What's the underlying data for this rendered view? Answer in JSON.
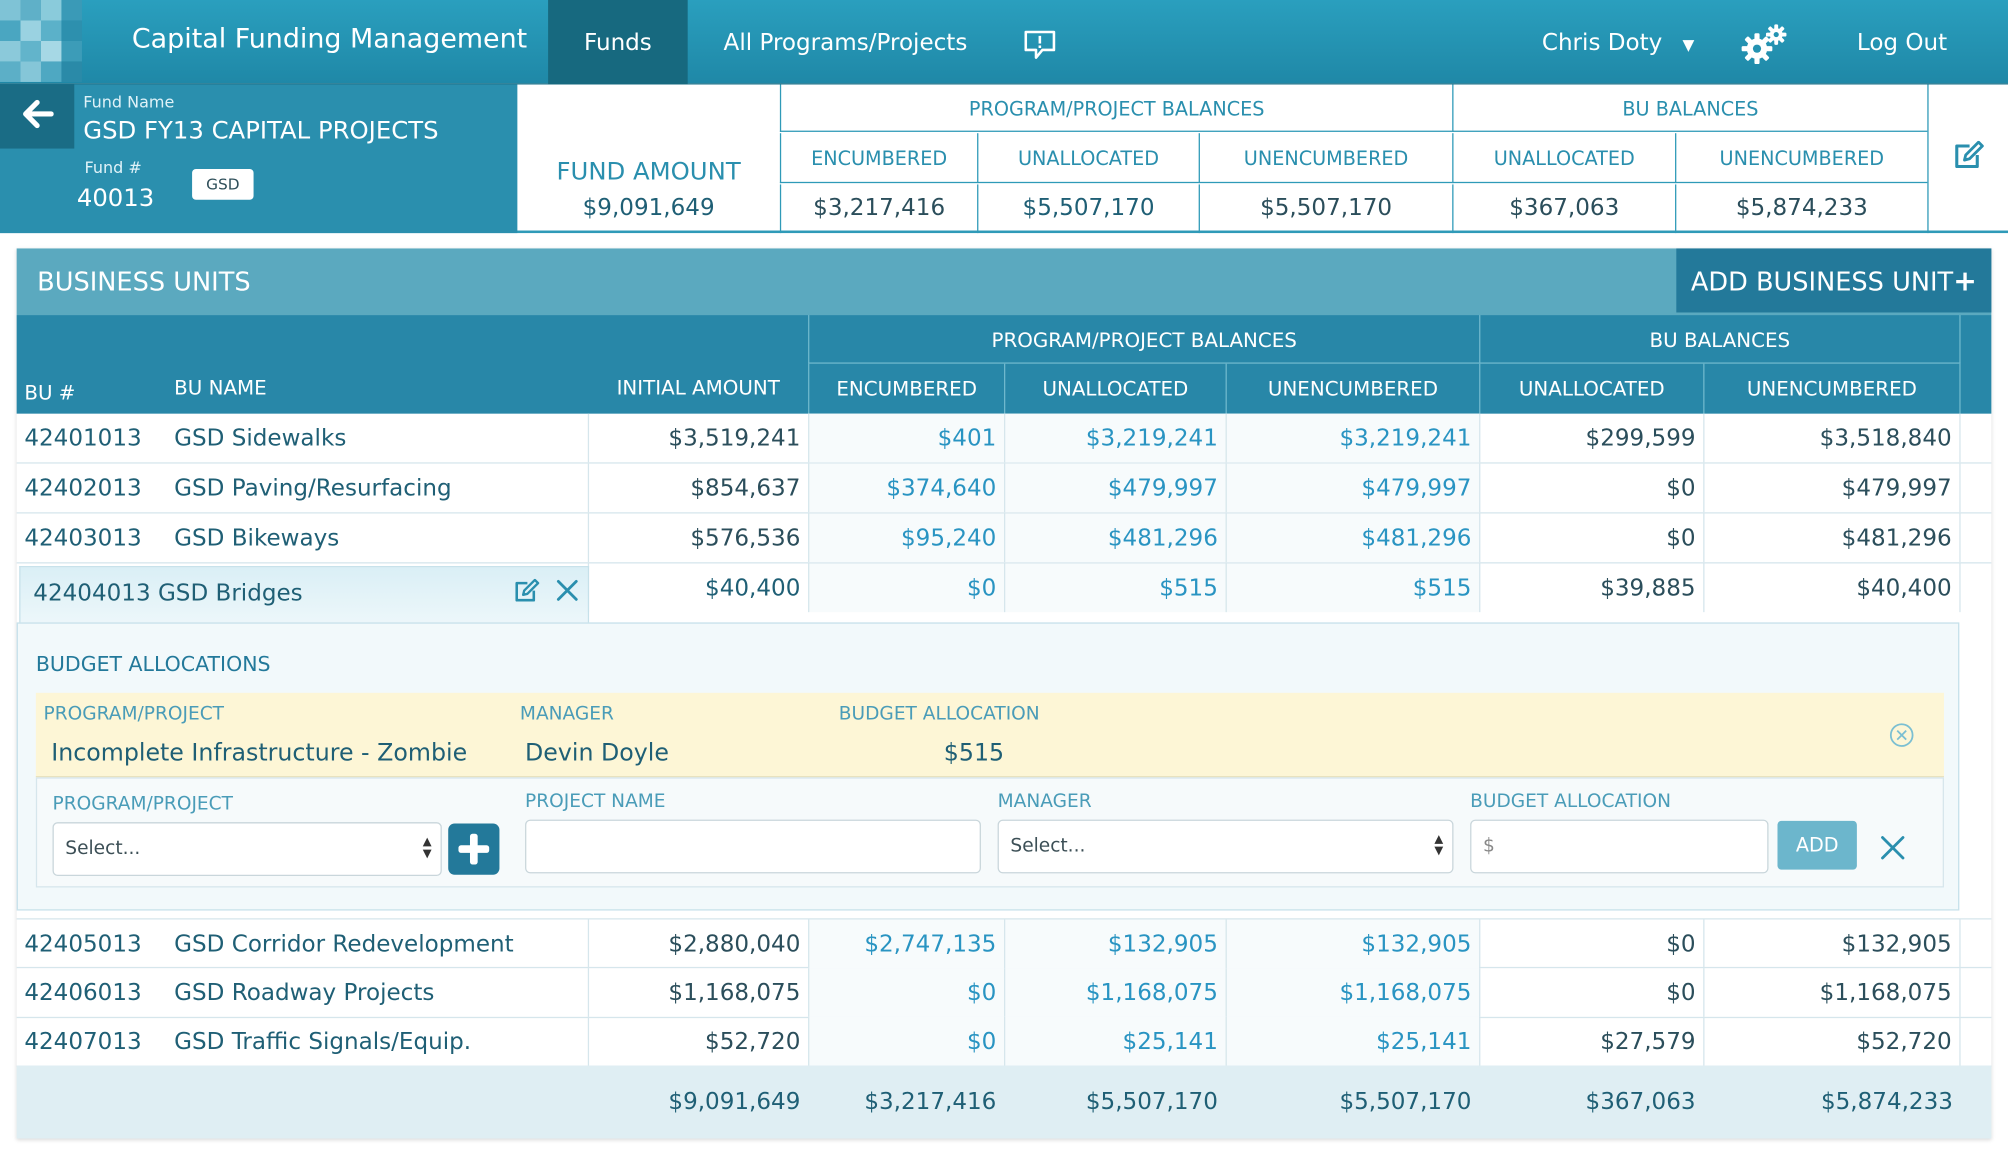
{
  "app_title": "Capital Funding Management",
  "nav": {
    "funds": "Funds",
    "programs": "All Programs/Projects",
    "user": "Chris Doty",
    "logout": "Log Out"
  },
  "fund": {
    "name_label": "Fund Name",
    "name": "GSD FY13 CAPITAL PROJECTS",
    "number_label": "Fund #",
    "number": "40013",
    "badge": "GSD",
    "amount_label": "FUND AMOUNT",
    "amount": "$9,091,649",
    "program_balances_label": "PROGRAM/PROJECT BALANCES",
    "bu_balances_label": "BU BALANCES",
    "columns": {
      "encumbered": "ENCUMBERED",
      "unallocated": "UNALLOCATED",
      "unencumbered": "UNENCUMBERED",
      "bu_unallocated": "UNALLOCATED",
      "bu_unencumbered": "UNENCUMBERED"
    },
    "values": {
      "encumbered": "$3,217,416",
      "unallocated": "$5,507,170",
      "unencumbered": "$5,507,170",
      "bu_unallocated": "$367,063",
      "bu_unencumbered": "$5,874,233"
    }
  },
  "business_units": {
    "title": "BUSINESS UNITS",
    "add_button": "ADD BUSINESS UNIT",
    "headers": {
      "bu_num": "BU #",
      "bu_name": "BU NAME",
      "initial": "INITIAL AMOUNT",
      "program_balances": "PROGRAM/PROJECT BALANCES",
      "bu_balances": "BU BALANCES",
      "encumbered": "ENCUMBERED",
      "unallocated": "UNALLOCATED",
      "unencumbered": "UNENCUMBERED",
      "bu_unallocated": "UNALLOCATED",
      "bu_unencumbered": "UNENCUMBERED"
    },
    "rows": [
      {
        "num": "42401013",
        "name": "GSD Sidewalks",
        "initial": "$3,519,241",
        "encumbered": "$401",
        "unallocated": "$3,219,241",
        "unencumbered": "$3,219,241",
        "bu_unallocated": "$299,599",
        "bu_unencumbered": "$3,518,840"
      },
      {
        "num": "42402013",
        "name": "GSD Paving/Resurfacing",
        "initial": "$854,637",
        "encumbered": "$374,640",
        "unallocated": "$479,997",
        "unencumbered": "$479,997",
        "bu_unallocated": "$0",
        "bu_unencumbered": "$479,997"
      },
      {
        "num": "42403013",
        "name": "GSD Bikeways",
        "initial": "$576,536",
        "encumbered": "$95,240",
        "unallocated": "$481,296",
        "unencumbered": "$481,296",
        "bu_unallocated": "$0",
        "bu_unencumbered": "$481,296"
      },
      {
        "num": "42404013",
        "name": "GSD Bridges",
        "initial": "$40,400",
        "encumbered": "$0",
        "unallocated": "$515",
        "unencumbered": "$515",
        "bu_unallocated": "$39,885",
        "bu_unencumbered": "$40,400"
      },
      {
        "num": "42405013",
        "name": "GSD Corridor Redevelopment",
        "initial": "$2,880,040",
        "encumbered": "$2,747,135",
        "unallocated": "$132,905",
        "unencumbered": "$132,905",
        "bu_unallocated": "$0",
        "bu_unencumbered": "$132,905"
      },
      {
        "num": "42406013",
        "name": "GSD Roadway Projects",
        "initial": "$1,168,075",
        "encumbered": "$0",
        "unallocated": "$1,168,075",
        "unencumbered": "$1,168,075",
        "bu_unallocated": "$0",
        "bu_unencumbered": "$1,168,075"
      },
      {
        "num": "42407013",
        "name": "GSD Traffic Signals/Equip.",
        "initial": "$52,720",
        "encumbered": "$0",
        "unallocated": "$25,141",
        "unencumbered": "$25,141",
        "bu_unallocated": "$27,579",
        "bu_unencumbered": "$52,720"
      }
    ],
    "expanded": {
      "title": "42404013 GSD Bridges",
      "budget_allocations_title": "BUDGET ALLOCATIONS",
      "labels": {
        "program": "PROGRAM/PROJECT",
        "manager": "MANAGER",
        "budget": "BUDGET ALLOCATION",
        "project_name": "PROJECT NAME"
      },
      "allocation": {
        "program": "Incomplete Infrastructure - Zombie",
        "manager": "Devin Doyle",
        "budget": "$515"
      },
      "new_allocation": {
        "program_placeholder": "Select...",
        "manager_placeholder": "Select...",
        "budget_prefix": "$",
        "add_button": "ADD"
      }
    },
    "totals": {
      "initial": "$9,091,649",
      "encumbered": "$3,217,416",
      "unallocated": "$5,507,170",
      "unencumbered": "$5,507,170",
      "bu_unallocated": "$367,063",
      "bu_unencumbered": "$5,874,233"
    }
  },
  "icons": {
    "back": "arrow-left-icon",
    "feedback": "speech-bubble-icon",
    "dropdown": "caret-down-icon",
    "settings": "gear-icon",
    "edit": "edit-icon",
    "close": "close-icon",
    "remove": "circle-x-icon",
    "add": "plus-icon",
    "select": "select-arrows-icon"
  },
  "colors": {
    "nav": "#2a9fbe",
    "nav_active": "#17697f",
    "header_teal": "#2887a8",
    "link_value": "#2994c2",
    "allocation_highlight": "#fdf6d6"
  }
}
